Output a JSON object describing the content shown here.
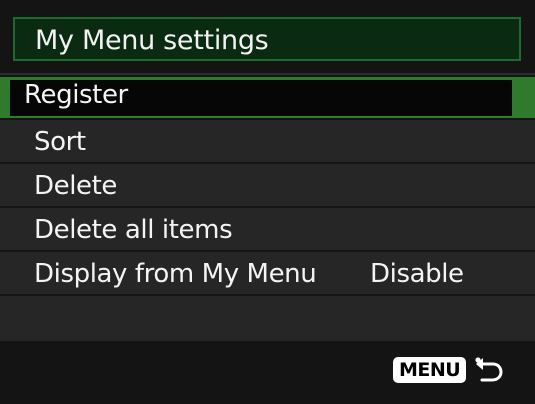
{
  "header": {
    "title": "My Menu settings"
  },
  "menu": {
    "items": [
      {
        "label": "Register",
        "value": ""
      },
      {
        "label": "Sort",
        "value": ""
      },
      {
        "label": "Delete",
        "value": ""
      },
      {
        "label": "Delete all items",
        "value": ""
      },
      {
        "label": "Display from My Menu",
        "value": "Disable"
      }
    ],
    "selected_index": 0
  },
  "footer": {
    "menu_button_label": "MENU",
    "return_icon": "return-arrow-icon"
  },
  "colors": {
    "accent_green": "#2f7a2c",
    "header_bg": "#0a2a12",
    "row_bg": "#262626",
    "background": "#141414"
  }
}
